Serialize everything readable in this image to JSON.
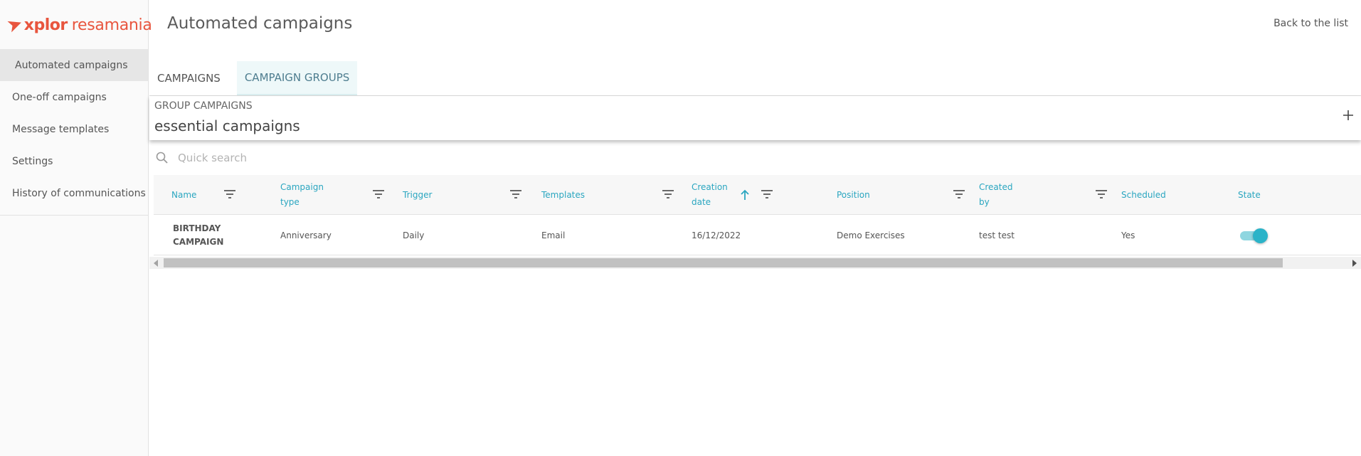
{
  "brand": {
    "logo_main": "xplor",
    "logo_sub": "resamania",
    "color": "#e8553e"
  },
  "sidebar": {
    "items": [
      {
        "label": "Automated campaigns",
        "active": true
      },
      {
        "label": "One-off campaigns"
      },
      {
        "label": "Message templates"
      },
      {
        "label": "Settings"
      },
      {
        "label": "History of communications"
      }
    ]
  },
  "header": {
    "title": "Automated campaigns",
    "back_label": "Back to the list"
  },
  "tabs": [
    {
      "label": "CAMPAIGNS"
    },
    {
      "label": "CAMPAIGN GROUPS",
      "active": true
    }
  ],
  "group": {
    "label": "GROUP CAMPAIGNS",
    "name": "essential campaigns",
    "add_icon": "plus-icon"
  },
  "search": {
    "placeholder": "Quick search",
    "value": ""
  },
  "table": {
    "columns": [
      {
        "label": "Name"
      },
      {
        "label": "Campaign type"
      },
      {
        "label": "Trigger"
      },
      {
        "label": "Templates"
      },
      {
        "label": "Creation date",
        "sorted": "asc"
      },
      {
        "label": "Position"
      },
      {
        "label": "Created by"
      },
      {
        "label": "Scheduled"
      },
      {
        "label": "State"
      }
    ],
    "rows": [
      {
        "name": "BIRTHDAY CAMPAIGN",
        "campaign_type": "Anniversary",
        "trigger": "Daily",
        "templates": "Email",
        "creation_date": "16/12/2022",
        "position": "Demo Exercises",
        "created_by": "test test",
        "scheduled": "Yes",
        "state": true
      }
    ]
  },
  "colors": {
    "accent": "#2aa6c0",
    "toggle_on": "#2bb3c8",
    "active_tab_bg": "#eef8f9"
  }
}
